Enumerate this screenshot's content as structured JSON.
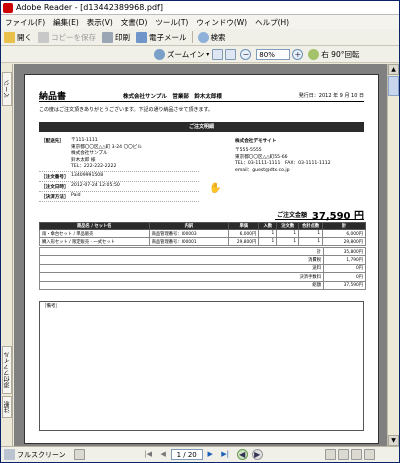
{
  "window": {
    "title": "Adobe Reader - [d13442389968.pdf]"
  },
  "menu": [
    "ファイル(F)",
    "編集(E)",
    "表示(V)",
    "文書(D)",
    "ツール(T)",
    "ウィンドウ(W)",
    "ヘルプ(H)"
  ],
  "toolbar1": {
    "open": "開く",
    "save_copy": "コピーを保存",
    "print": "印刷",
    "email": "電子メール",
    "search": "検索"
  },
  "toolbar2": {
    "zoom_in": "ズームイン",
    "zoom_value": "80%",
    "rotate": "右 90°回転"
  },
  "sidebar": {
    "tab_top": "ページ",
    "tab_bottom": "添付ファイル",
    "tab_bottom2": "注釈"
  },
  "document": {
    "title": "納品書",
    "shop_line": "株式会社サンプル　営業部　鈴木太郎様",
    "issue_date": "発行日：2012 年 9 月 10 日",
    "thanks": "この度はご注文頂きありがとうございます。下記の通り納品させて頂きます。",
    "banner": "ご注文明細",
    "delivery_label": "［配送先］",
    "delivery_lines": [
      "〒111-1111",
      "東京都〇〇区△△町 3-24 〇〇ビル",
      "株式会社サンプル",
      "鈴木太郎 様",
      "TEL：222-222-2222"
    ],
    "seller_name": "株式会社デモサイト",
    "seller_lines": [
      "〒555-5555",
      "東京都〇〇区△△町55-66",
      "TEL：03-1111-1111　FAX：03-1111-1112",
      "email：guest@dtx.co.jp"
    ],
    "order_no_label": "［注文番号］",
    "order_no": "13409991508",
    "order_date_label": "［注文日時］",
    "order_date": "2012-07-24 12:05:50",
    "payment_label": "［決済方法］",
    "payment": "Paid",
    "total_label": "ご注文金額",
    "total_value": "37,590 円",
    "table_headers": [
      "商品名 / セット名",
      "内訳",
      "単価",
      "入数",
      "注文数",
      "合計点数",
      "計"
    ],
    "rows": [
      [
        "雨・傘台セット / 単品販売",
        "商品管理番号：I00003",
        "6,000円",
        "1",
        "1",
        "1",
        "6,000円"
      ],
      [
        "鯛入形セット / 限定販売 - 一式セット",
        "商品管理番号：I00001",
        "29,800円",
        "1",
        "1",
        "1",
        "29,800円"
      ]
    ],
    "summary": [
      {
        "label": "計",
        "value": "35,800円"
      },
      {
        "label": "消費税",
        "value": "1,790円"
      },
      {
        "label": "送料",
        "value": "0円"
      },
      {
        "label": "決済手数料",
        "value": "0円"
      },
      {
        "label": "総額",
        "value": "37,590円"
      }
    ],
    "notes_label": "［備考］"
  },
  "status": {
    "fullscreen": "フルスクリーン",
    "page_indicator": "1 / 20"
  }
}
